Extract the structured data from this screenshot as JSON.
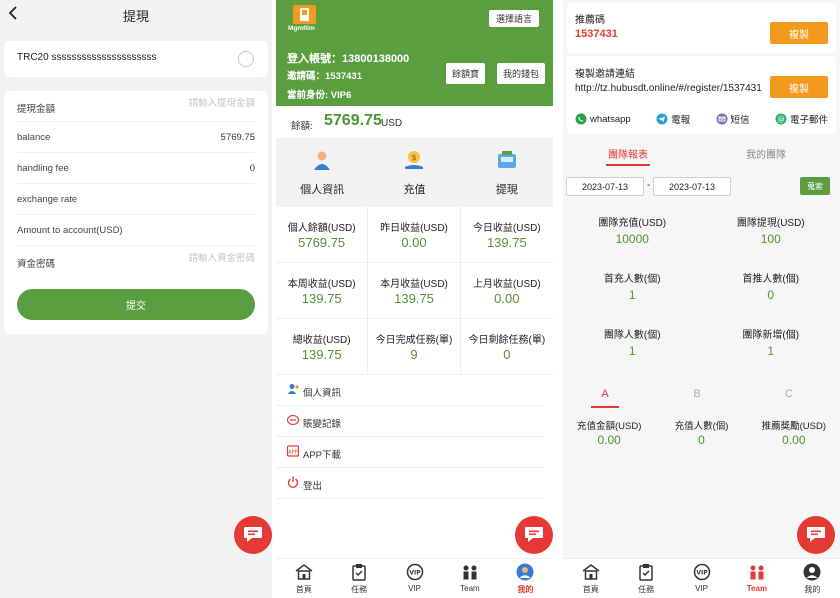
{
  "withdraw": {
    "title": "提現",
    "network": "TRC20 sssssssssssssssssssss",
    "fields": {
      "amount": {
        "label": "提現金額",
        "placeholder": "請輸入提現金額"
      },
      "balance": {
        "label": "balance",
        "value": "5769.75"
      },
      "fee": {
        "label": "handling fee",
        "value": "0"
      },
      "rate": {
        "label": "exchange rate",
        "value": ""
      },
      "to_account": {
        "label": "Amount to account(USD)",
        "value": ""
      },
      "password": {
        "label": "資金密碼",
        "placeholder": "請輸入資金密碼"
      }
    },
    "submit_label": "提交"
  },
  "profile": {
    "logo_text": "Mgmfilm",
    "language_button": "選擇語言",
    "account_line": "登入帳號：13800138000",
    "invite_line": "邀請碼：1537431",
    "level_line": "當前身份: VIP6",
    "balance_wallet_button": "餘額寶",
    "my_wallet_button": "我的錢包",
    "balance_label": "餘額:",
    "balance_value": "5769.75",
    "balance_unit": "USD",
    "actions": [
      {
        "label": "個人資訊"
      },
      {
        "label": "充值"
      },
      {
        "label": "提現"
      }
    ],
    "stats": [
      {
        "label": "個人餘額(USD)",
        "value": "5769.75"
      },
      {
        "label": "昨日收益(USD)",
        "value": "0.00"
      },
      {
        "label": "今日收益(USD)",
        "value": "139.75"
      },
      {
        "label": "本周收益(USD)",
        "value": "139.75"
      },
      {
        "label": "本月收益(USD)",
        "value": "139.75"
      },
      {
        "label": "上月收益(USD)",
        "value": "0.00"
      },
      {
        "label": "總收益(USD)",
        "value": "139.75"
      },
      {
        "label": "今日完成任務(單)",
        "value": "9"
      },
      {
        "label": "今日剩餘任務(單)",
        "value": "0"
      }
    ],
    "menu": [
      {
        "label": "個人資訊"
      },
      {
        "label": "賬變記錄"
      },
      {
        "label": "APP下載"
      },
      {
        "label": "登出"
      }
    ]
  },
  "team": {
    "referral_title": "推薦碼",
    "referral_code": "1537431",
    "copy_label": "複製",
    "link_title": "複製邀請連結",
    "link_url": "http://tz.hubusdt.online/#/register/1537431",
    "share": [
      {
        "label": "whatsapp"
      },
      {
        "label": "電報"
      },
      {
        "label": "短信"
      },
      {
        "label": "電子郵件"
      }
    ],
    "tabs": {
      "report": "團隊報表",
      "mine": "我的團隊"
    },
    "date_from": "2023-07-13",
    "date_sep": "-",
    "date_to": "2023-07-13",
    "search_label": "蒐索",
    "stats": [
      {
        "label": "團隊充值(USD)",
        "value": "10000"
      },
      {
        "label": "團隊提現(USD)",
        "value": "100"
      },
      {
        "label": "首充人數(個)",
        "value": "1"
      },
      {
        "label": "首推人數(個)",
        "value": "0"
      },
      {
        "label": "團隊人數(個)",
        "value": "1"
      },
      {
        "label": "團隊新增(個)",
        "value": "1"
      }
    ],
    "levels": [
      "A",
      "B",
      "C"
    ],
    "level_stats": [
      {
        "label": "充值金額(USD)",
        "value": "0.00"
      },
      {
        "label": "充值人數(個)",
        "value": "0"
      },
      {
        "label": "推薦獎勵(USD)",
        "value": "0.00"
      }
    ]
  },
  "tabbar": [
    "首頁",
    "任務",
    "VIP",
    "Team",
    "我的"
  ],
  "colors": {
    "primary_green": "#5a9e3f",
    "accent_red": "#e53935",
    "orange": "#f39a1e"
  }
}
